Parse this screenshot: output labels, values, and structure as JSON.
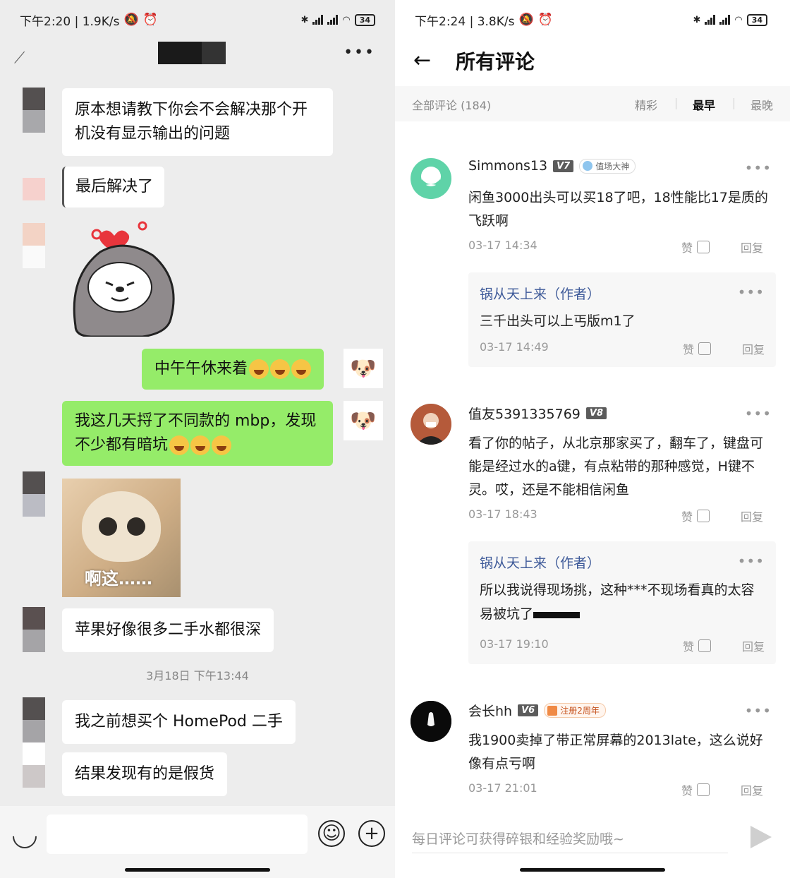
{
  "left": {
    "status": {
      "time": "下午2:20 | 1.9K/s",
      "battery": "34"
    },
    "messages_in": [
      "原本想请教下你会不会解决那个开\n机没有显示输出的问题",
      "最后解决了",
      "苹果好像很多二手水都很深",
      "我之前想买个 HomePod 二手",
      "结果发现有的是假货"
    ],
    "messages_out": [
      "中午午休来着",
      "我这几天捋了不同款的 mbp，发现\n不少都有暗坑"
    ],
    "image_caption": "啊这……",
    "timestamp": "3月18日 下午13:44"
  },
  "right": {
    "status": {
      "time": "下午2:24 | 3.8K/s",
      "battery": "34"
    },
    "title": "所有评论",
    "sort": {
      "count_label": "全部评论 (184)",
      "opt1": "精彩",
      "opt2": "最早",
      "opt3": "最晚"
    },
    "like_label": "赞",
    "reply_label": "回复",
    "comments": [
      {
        "user": "Simmons13",
        "level": "V7",
        "badge": "值场大神",
        "text": "闲鱼3000出头可以买18了吧，18性能比17是质的飞跃啊",
        "time": "03-17 14:34",
        "reply": {
          "user": "锅从天上来（作者）",
          "text": "三千出头可以上丐版m1了",
          "time": "03-17 14:49"
        }
      },
      {
        "user": "值友5391335769",
        "level": "V8",
        "text": "看了你的帖子，从北京那家买了，翻车了，键盘可能是经过水的a键，有点粘带的那种感觉，H键不灵。哎，还是不能相信闲鱼",
        "time": "03-17 18:43",
        "reply": {
          "user": "锅从天上来（作者）",
          "text": "所以我说得现场挑，这种***不现场看真的太容易被坑了",
          "time": "03-17 19:10"
        }
      },
      {
        "user": "会长hh",
        "level": "V6",
        "badge": "注册2周年",
        "text": "我1900卖掉了带正常屏幕的2013late，这么说好像有点亏啊",
        "time": "03-17 21:01"
      }
    ],
    "input_placeholder": "每日评论可获得碎银和经验奖励哦~",
    "colors": {
      "accent_blue": "#3e5a99",
      "avatar_teal": "#5fd3a8",
      "wechat_green": "#95ec69"
    }
  }
}
